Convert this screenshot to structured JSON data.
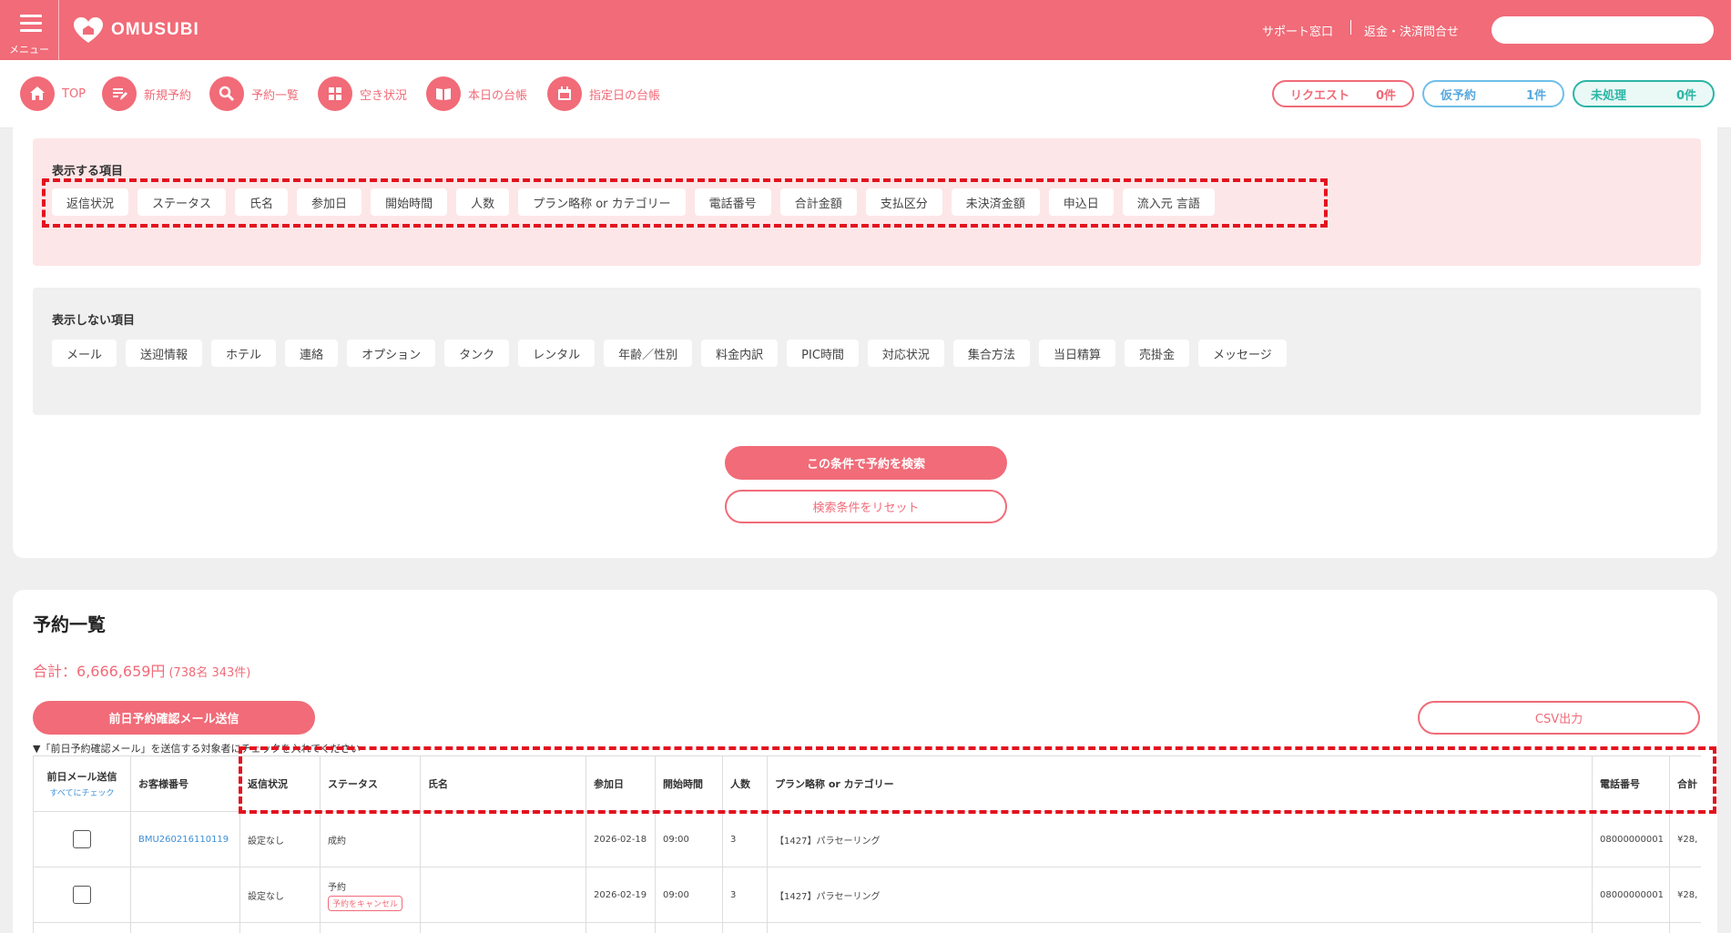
{
  "header": {
    "menu_label": "メニュー",
    "logo_text": "OMUSUBI",
    "support_link": "サポート窓口",
    "refund_link": "返金・決済問合せ",
    "search_value": ""
  },
  "nav": {
    "items": [
      {
        "label": "TOP",
        "icon": "home-icon"
      },
      {
        "label": "新規予約",
        "icon": "edit-icon"
      },
      {
        "label": "予約一覧",
        "icon": "search-icon"
      },
      {
        "label": "空き状況",
        "icon": "grid-icon"
      },
      {
        "label": "本日の台帳",
        "icon": "book-icon"
      },
      {
        "label": "指定日の台帳",
        "icon": "calendar-icon"
      }
    ],
    "counts": [
      {
        "label": "リクエスト",
        "count": "0件"
      },
      {
        "label": "仮予約",
        "count": "1件"
      },
      {
        "label": "未処理",
        "count": "0件"
      }
    ]
  },
  "display_settings": {
    "shown_title": "表示する項目",
    "shown_items": [
      "返信状況",
      "ステータス",
      "氏名",
      "参加日",
      "開始時間",
      "人数",
      "プラン略称 or カテゴリー",
      "電話番号",
      "合計金額",
      "支払区分",
      "未決済金額",
      "申込日",
      "流入元 言語"
    ],
    "hidden_title": "表示しない項目",
    "hidden_items": [
      "メール",
      "送迎情報",
      "ホテル",
      "連絡",
      "オプション",
      "タンク",
      "レンタル",
      "年齢／性別",
      "料金内訳",
      "PIC時間",
      "対応状況",
      "集合方法",
      "当日精算",
      "売掛金",
      "メッセージ"
    ],
    "search_button": "この条件で予約を検索",
    "reset_button": "検索条件をリセット"
  },
  "list": {
    "title": "予約一覧",
    "total": "合計：6,666,659円",
    "total_sub": "(738名 343件)",
    "mail_button": "前日予約確認メール送信",
    "csv_button": "CSV出力",
    "note": "▼「前日予約確認メール」を送信する対象者にチェックを入れてください",
    "columns": {
      "mail": "前日メール送信",
      "check_all": "すべてにチェック",
      "customer_no": "お客様番号",
      "reply": "返信状況",
      "status": "ステータス",
      "name": "氏名",
      "date": "参加日",
      "start": "開始時間",
      "people": "人数",
      "plan": "プラン略称 or カテゴリー",
      "phone": "電話番号",
      "total": "合計"
    },
    "rows": [
      {
        "customer_no": "BMU260216110119",
        "reply": "設定なし",
        "status": "成約",
        "cancel": "",
        "name": "",
        "date": "2026-02-18",
        "start": "09:00",
        "people": "3",
        "plan": "【1427】パラセーリング",
        "phone": "08000000001",
        "total": "¥28,"
      },
      {
        "customer_no": "",
        "reply": "設定なし",
        "status": "予約",
        "cancel": "予約をキャンセル",
        "name": "",
        "date": "2026-02-19",
        "start": "09:00",
        "people": "3",
        "plan": "【1427】パラセーリング",
        "phone": "08000000001",
        "total": "¥28,"
      }
    ]
  },
  "colors": {
    "brand": "#f16b78",
    "blue": "#6fbfe9",
    "teal": "#2bb5a5",
    "highlight": "#e3121f"
  }
}
